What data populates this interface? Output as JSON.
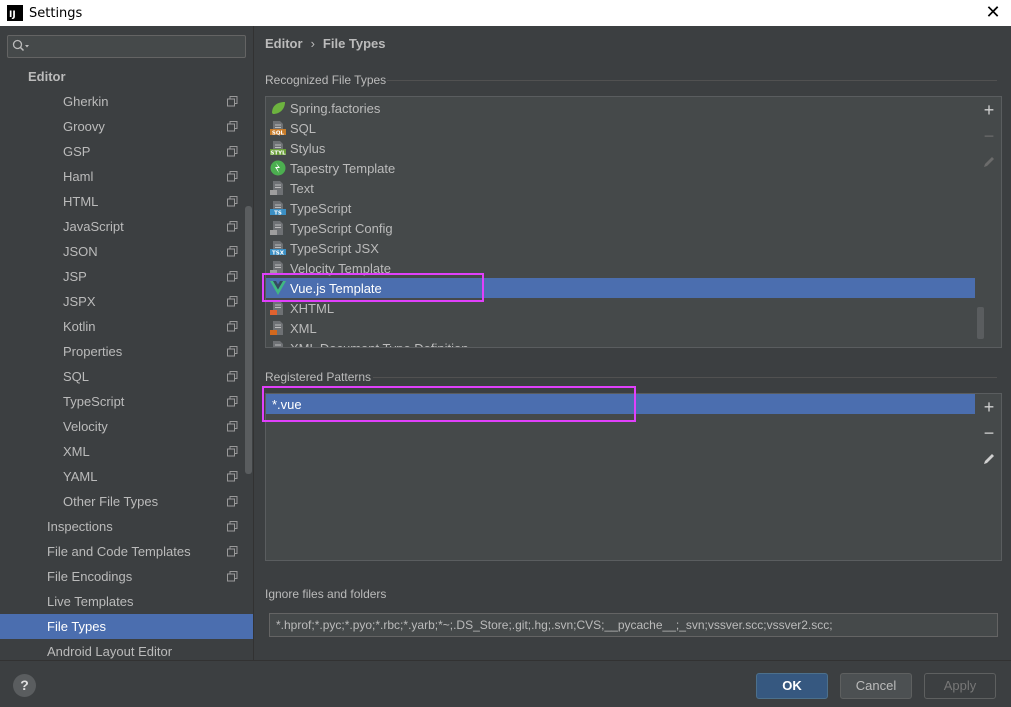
{
  "window": {
    "title": "Settings",
    "app_icon_label": "IJ"
  },
  "search": {
    "placeholder": "",
    "value": ""
  },
  "sidebar": {
    "items": [
      {
        "label": "Editor",
        "level": 0,
        "copy_icon": false,
        "selected": false
      },
      {
        "label": "Gherkin",
        "level": 2,
        "copy_icon": true,
        "selected": false
      },
      {
        "label": "Groovy",
        "level": 2,
        "copy_icon": true,
        "selected": false
      },
      {
        "label": "GSP",
        "level": 2,
        "copy_icon": true,
        "selected": false
      },
      {
        "label": "Haml",
        "level": 2,
        "copy_icon": true,
        "selected": false
      },
      {
        "label": "HTML",
        "level": 2,
        "copy_icon": true,
        "selected": false
      },
      {
        "label": "JavaScript",
        "level": 2,
        "copy_icon": true,
        "selected": false
      },
      {
        "label": "JSON",
        "level": 2,
        "copy_icon": true,
        "selected": false
      },
      {
        "label": "JSP",
        "level": 2,
        "copy_icon": true,
        "selected": false
      },
      {
        "label": "JSPX",
        "level": 2,
        "copy_icon": true,
        "selected": false
      },
      {
        "label": "Kotlin",
        "level": 2,
        "copy_icon": true,
        "selected": false
      },
      {
        "label": "Properties",
        "level": 2,
        "copy_icon": true,
        "selected": false
      },
      {
        "label": "SQL",
        "level": 2,
        "copy_icon": true,
        "selected": false
      },
      {
        "label": "TypeScript",
        "level": 2,
        "copy_icon": true,
        "selected": false
      },
      {
        "label": "Velocity",
        "level": 2,
        "copy_icon": true,
        "selected": false
      },
      {
        "label": "XML",
        "level": 2,
        "copy_icon": true,
        "selected": false
      },
      {
        "label": "YAML",
        "level": 2,
        "copy_icon": true,
        "selected": false
      },
      {
        "label": "Other File Types",
        "level": 2,
        "copy_icon": true,
        "selected": false
      },
      {
        "label": "Inspections",
        "level": 1,
        "copy_icon": true,
        "selected": false
      },
      {
        "label": "File and Code Templates",
        "level": 1,
        "copy_icon": true,
        "selected": false
      },
      {
        "label": "File Encodings",
        "level": 1,
        "copy_icon": true,
        "selected": false
      },
      {
        "label": "Live Templates",
        "level": 1,
        "copy_icon": false,
        "selected": false
      },
      {
        "label": "File Types",
        "level": 1,
        "copy_icon": false,
        "selected": true
      },
      {
        "label": "Android Layout Editor",
        "level": 1,
        "copy_icon": false,
        "selected": false
      }
    ]
  },
  "breadcrumb": {
    "parent": "Editor",
    "separator": "›",
    "current": "File Types"
  },
  "recognized": {
    "label": "Recognized File Types",
    "items": [
      {
        "label": "Spring.factories",
        "icon": "spring-leaf-icon",
        "color": "#6db33f",
        "tag": "",
        "selected": false
      },
      {
        "label": "SQL",
        "icon": "sql-file-icon",
        "color": "#c77c2a",
        "tag": "SQL",
        "selected": false
      },
      {
        "label": "Stylus",
        "icon": "stylus-file-icon",
        "color": "#6a9e3a",
        "tag": "STYL",
        "selected": false
      },
      {
        "label": "Tapestry Template",
        "icon": "tapestry-icon",
        "color": "#4caf50",
        "tag": "",
        "selected": false
      },
      {
        "label": "Text",
        "icon": "text-file-icon",
        "color": "#9e9e9e",
        "tag": "",
        "selected": false
      },
      {
        "label": "TypeScript",
        "icon": "typescript-file-icon",
        "color": "#3b8fc4",
        "tag": "TS",
        "selected": false
      },
      {
        "label": "TypeScript Config",
        "icon": "tsconfig-file-icon",
        "color": "#9e9e9e",
        "tag": "",
        "selected": false
      },
      {
        "label": "TypeScript JSX",
        "icon": "tsx-file-icon",
        "color": "#3b8fc4",
        "tag": "TSX",
        "selected": false
      },
      {
        "label": "Velocity Template",
        "icon": "velocity-icon",
        "color": "#9e9e9e",
        "tag": "",
        "selected": false
      },
      {
        "label": "Vue.js Template",
        "icon": "vue-icon",
        "color": "#41b883",
        "tag": "",
        "selected": true
      },
      {
        "label": "XHTML",
        "icon": "xhtml-file-icon",
        "color": "#e0622f",
        "tag": "",
        "selected": false
      },
      {
        "label": "XML",
        "icon": "xml-file-icon",
        "color": "#d2691e",
        "tag": "",
        "selected": false
      },
      {
        "label": "XML Document Type Definition",
        "icon": "dtd-file-icon",
        "color": "#9e9e9e",
        "tag": "",
        "selected": false
      }
    ]
  },
  "patterns": {
    "label": "Registered Patterns",
    "items": [
      "*.vue"
    ]
  },
  "ignore": {
    "label": "Ignore files and folders",
    "value": "*.hprof;*.pyc;*.pyo;*.rbc;*.yarb;*~;.DS_Store;.git;.hg;.svn;CVS;__pycache__;_svn;vssver.scc;vssver2.scc;"
  },
  "buttons": {
    "ok": "OK",
    "cancel": "Cancel",
    "apply": "Apply",
    "help": "?"
  },
  "colors": {
    "selection": "#4b6eaf",
    "highlight": "#e040fb",
    "background": "#3c3f41"
  }
}
